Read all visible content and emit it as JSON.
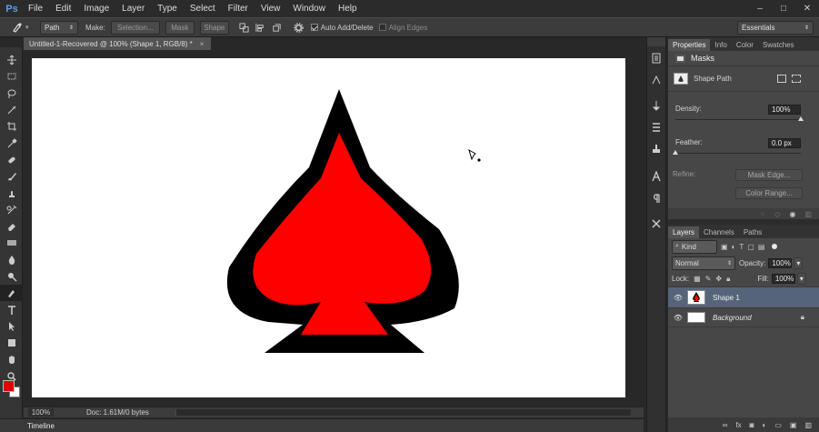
{
  "app": {
    "logo": "Ps"
  },
  "menu": [
    "File",
    "Edit",
    "Image",
    "Layer",
    "Type",
    "Select",
    "Filter",
    "View",
    "Window",
    "Help"
  ],
  "window_controls": {
    "minimize": "–",
    "maximize": "□",
    "close": "✕"
  },
  "options_bar": {
    "mode_value": "Path",
    "make_label": "Make:",
    "selection_button": "Selection...",
    "mask_button": "Mask",
    "shape_button": "Shape",
    "auto_add_delete": {
      "label": "Auto Add/Delete",
      "checked": true
    },
    "align_edges": {
      "label": "Align Edges",
      "checked": false
    },
    "workspace": "Essentials"
  },
  "document": {
    "tab_title": "Untitled-1-Recovered @ 100% (Shape 1, RGB/8) *",
    "close": "×"
  },
  "status": {
    "zoom": "100%",
    "doc": "Doc: 1.61M/0 bytes"
  },
  "timeline_label": "Timeline",
  "colors": {
    "foreground": "#e00000",
    "background": "#ffffff",
    "shape_fill": "#ff0000",
    "shape_stroke": "#000000"
  },
  "properties": {
    "tabs": [
      "Properties",
      "Info",
      "Color",
      "Swatches"
    ],
    "title": "Masks",
    "shape_path_label": "Shape Path",
    "density_label": "Density:",
    "density_value": "100%",
    "feather_label": "Feather:",
    "feather_value": "0.0 px",
    "refine_label": "Refine:",
    "mask_edge_button": "Mask Edge...",
    "color_range_button": "Color Range...",
    "density_level": 1.0,
    "feather_level": 0.0
  },
  "layers": {
    "tabs": [
      "Layers",
      "Channels",
      "Paths"
    ],
    "filter_kind": "Kind",
    "blend_mode": "Normal",
    "opacity_label": "Opacity:",
    "opacity_value": "100%",
    "lock_label": "Lock:",
    "fill_label": "Fill:",
    "fill_value": "100%",
    "items": [
      {
        "name": "Shape 1",
        "selected": true
      },
      {
        "name": "Background",
        "selected": false,
        "locked": true
      }
    ]
  }
}
